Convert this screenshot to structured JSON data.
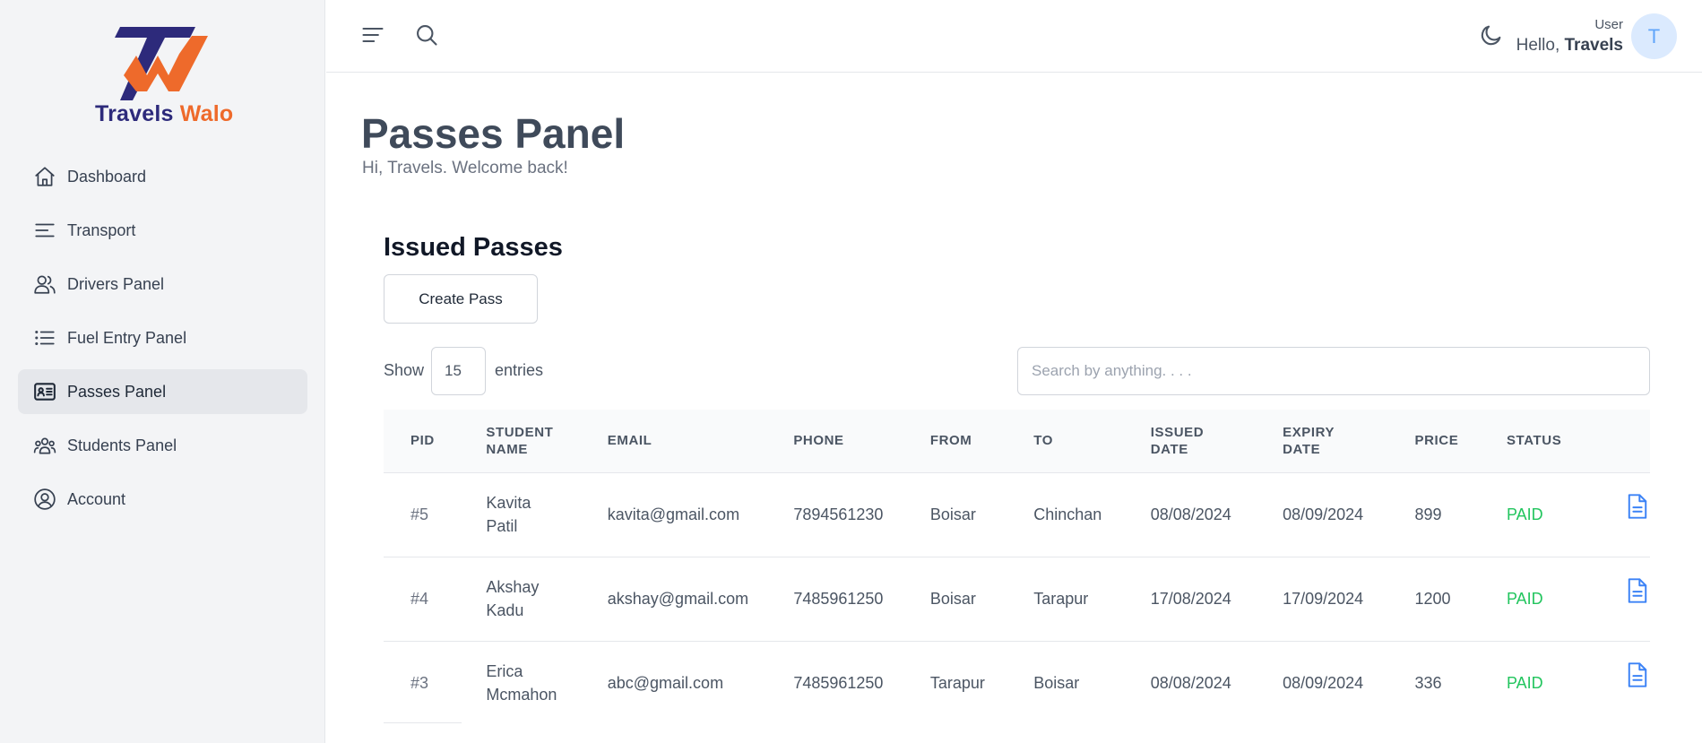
{
  "brand": {
    "name_part1": "Travels",
    "name_part2": "Walo",
    "primary_color": "#2d2a7b",
    "accent_color": "#ee6a2b"
  },
  "sidebar": {
    "items": [
      {
        "label": "Dashboard",
        "icon": "home-icon"
      },
      {
        "label": "Transport",
        "icon": "menu-lines-icon"
      },
      {
        "label": "Drivers Panel",
        "icon": "users-icon"
      },
      {
        "label": "Fuel Entry Panel",
        "icon": "list-icon"
      },
      {
        "label": "Passes Panel",
        "icon": "id-card-icon",
        "active": true
      },
      {
        "label": "Students Panel",
        "icon": "user-group-icon"
      },
      {
        "label": "Account",
        "icon": "user-circle-icon"
      }
    ]
  },
  "header": {
    "user_role": "User",
    "hello_prefix": "Hello,",
    "hello_name": "Travels",
    "avatar_initial": "T"
  },
  "page": {
    "title": "Passes Panel",
    "subtitle": "Hi, Travels. Welcome back!"
  },
  "section": {
    "title": "Issued Passes",
    "create_button": "Create Pass",
    "show_label": "Show",
    "entries_value": "15",
    "entries_label": "entries",
    "search_placeholder": "Search by anything. . . ."
  },
  "table": {
    "columns": {
      "pid": "PID",
      "name_1": "STUDENT",
      "name_2": "NAME",
      "email": "EMAIL",
      "phone": "PHONE",
      "from": "FROM",
      "to": "TO",
      "issued_1": "ISSUED",
      "issued_2": "DATE",
      "expiry_1": "EXPIRY",
      "expiry_2": "DATE",
      "price": "PRICE",
      "status": "STATUS"
    },
    "rows": [
      {
        "pid": "#5",
        "first": "Kavita",
        "last": "Patil",
        "email": "kavita@gmail.com",
        "phone": "7894561230",
        "from": "Boisar",
        "to": "Chinchan",
        "issued": "08/08/2024",
        "expiry": "08/09/2024",
        "price": "899",
        "status": "PAID"
      },
      {
        "pid": "#4",
        "first": "Akshay",
        "last": "Kadu",
        "email": "akshay@gmail.com",
        "phone": "7485961250",
        "from": "Boisar",
        "to": "Tarapur",
        "issued": "17/08/2024",
        "expiry": "17/09/2024",
        "price": "1200",
        "status": "PAID"
      },
      {
        "pid": "#3",
        "first": "Erica",
        "last": "Mcmahon",
        "email": "abc@gmail.com",
        "phone": "7485961250",
        "from": "Tarapur",
        "to": "Boisar",
        "issued": "08/08/2024",
        "expiry": "08/09/2024",
        "price": "336",
        "status": "PAID"
      }
    ],
    "status_color": "#22c55e",
    "row_action_icon": "document-icon"
  }
}
